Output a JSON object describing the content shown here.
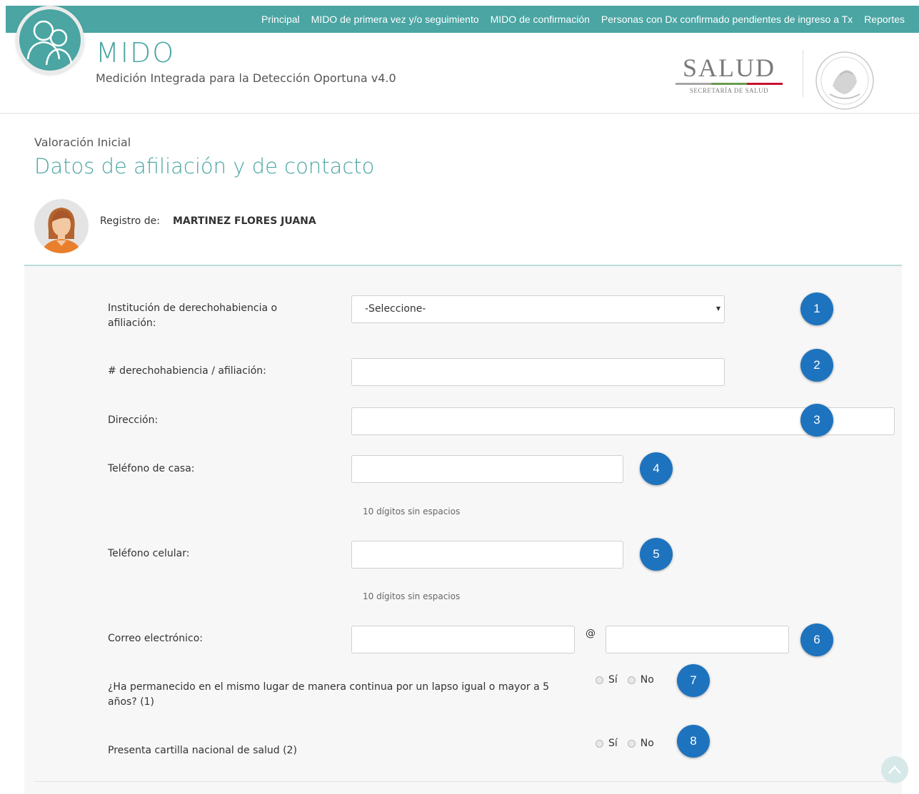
{
  "header": {
    "nav": [
      "Principal",
      "MIDO de primera vez y/o seguimiento",
      "MIDO de confirmación",
      "Personas con Dx confirmado pendientes de ingreso a Tx",
      "Reportes"
    ],
    "app_title": "MIDO",
    "app_subtitle": "Medición Integrada para la Detección Oportuna v4.0",
    "salud_word": "SALUD",
    "salud_sub": "SECRETARÍA DE SALUD",
    "brand_color": "#4aa5a3"
  },
  "page": {
    "section": "Valoración Inicial",
    "title": "Datos de afiliación y de contacto",
    "registro_label": "Registro de:",
    "registro_name": "MARTINEZ FLORES JUANA"
  },
  "form": {
    "institucion": {
      "label": "Institución de derechohabiencia o afiliación:",
      "selected": "-Seleccione-",
      "badge": "1"
    },
    "num_afiliacion": {
      "label": "# derechohabiencia / afiliación:",
      "value": "",
      "badge": "2"
    },
    "direccion": {
      "label": "Dirección:",
      "value": "",
      "badge": "3"
    },
    "tel_casa": {
      "label": "Teléfono de casa:",
      "value": "",
      "hint": "10 dígitos sin espacios",
      "badge": "4"
    },
    "tel_celular": {
      "label": "Teléfono celular:",
      "value": "",
      "hint": "10 dígitos sin espacios",
      "badge": "5"
    },
    "correo": {
      "label": "Correo electrónico:",
      "user": "",
      "at": "@",
      "domain": "",
      "badge": "6"
    },
    "permanencia": {
      "label": "¿Ha permanecido en el mismo lugar de manera continua por un lapso igual o mayor a 5 años? (1)",
      "yes": "Sí",
      "no": "No",
      "badge": "7"
    },
    "cartilla": {
      "label": "Presenta cartilla nacional de salud (2)",
      "yes": "Sí",
      "no": "No",
      "badge": "8"
    }
  }
}
